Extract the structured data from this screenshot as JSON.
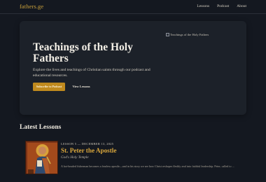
{
  "nav": {
    "brand": "fathers.ge",
    "links": [
      "Lessons",
      "Podcast",
      "About"
    ]
  },
  "hero": {
    "title": "Teachings of the Holy Fathers",
    "subtitle": "Explore the lives and teachings of Christian saints through our podcast and educational resources.",
    "primary_button": "Subscribe to Podcast",
    "secondary_button": "View Lessons",
    "image_alt": "Teachings of the Holy Fathers"
  },
  "latest": {
    "heading": "Latest Lessons",
    "lessons": [
      {
        "meta": "LESSON 5 — DECEMBER 13, 2025",
        "title": "St. Peter the Apostle",
        "subtitle": "God's Holy Temple",
        "description": "A hot-headed fisherman becomes a fearless apostle—and in his story we see how Christ reshapes fleshly zeal into faithful leadership. Peter, called to ..."
      }
    ]
  },
  "colors": {
    "background": "#141820",
    "hero_panel": "#1c2129",
    "accent": "#c08a1e",
    "brand": "#c9a03a",
    "lesson_title": "#d8a63c"
  }
}
